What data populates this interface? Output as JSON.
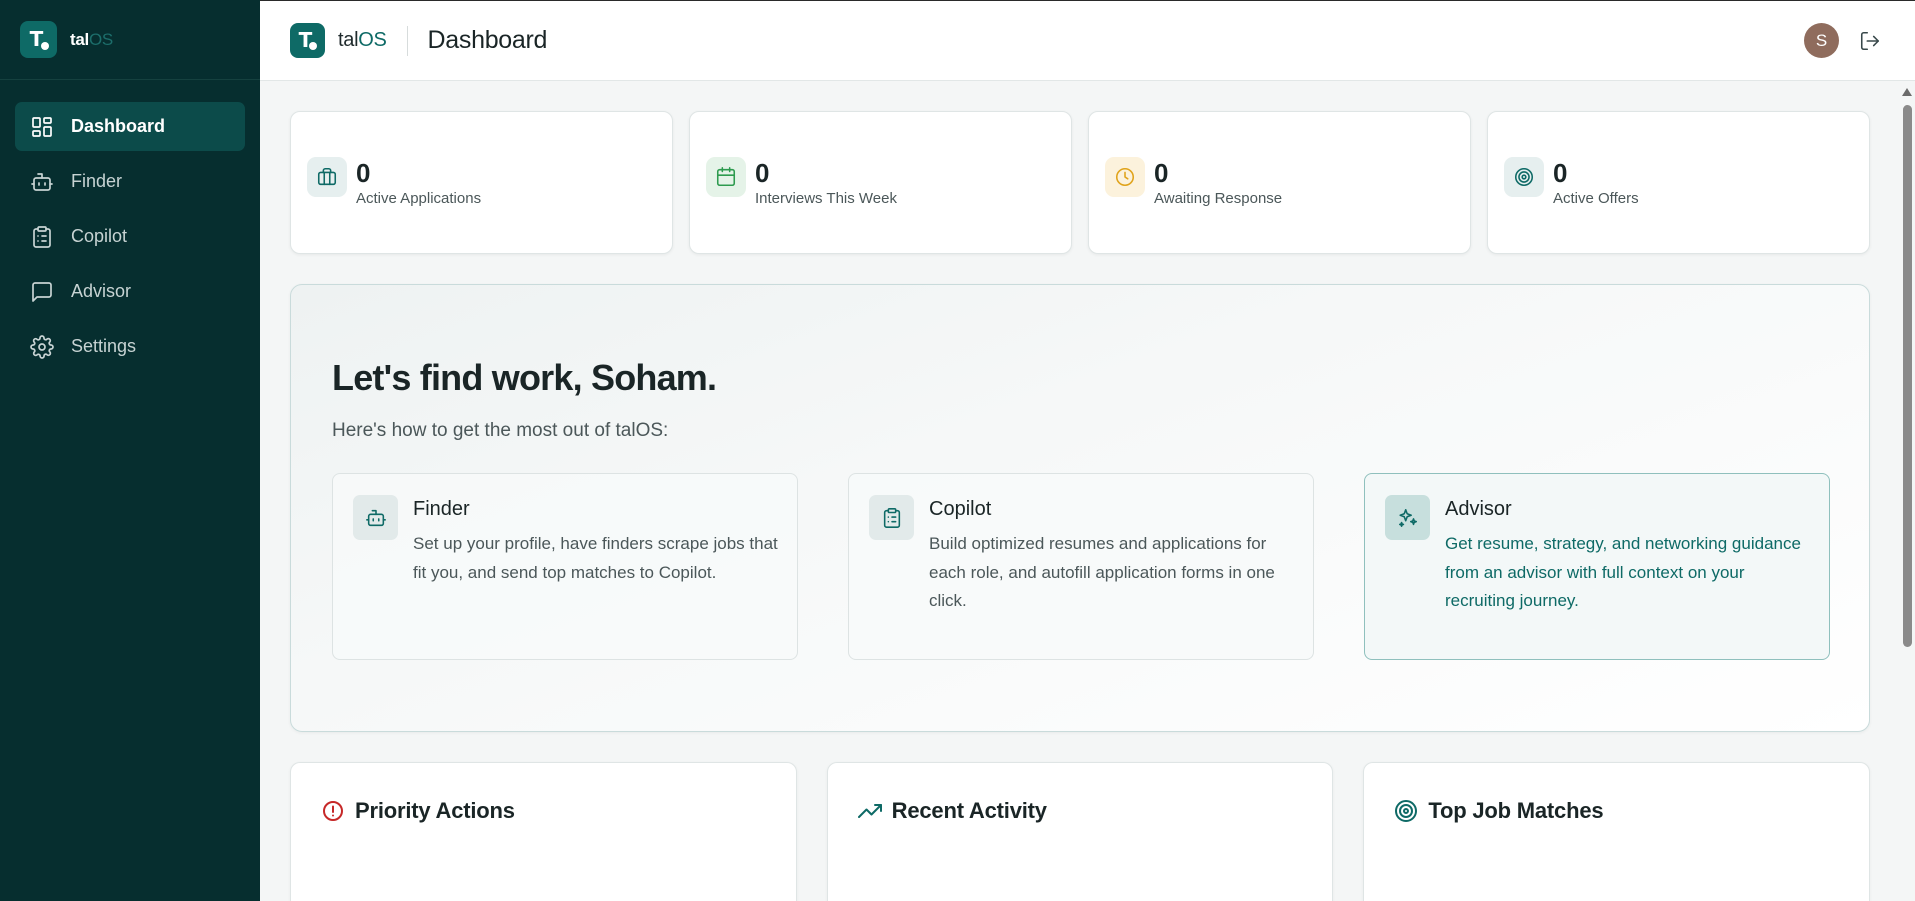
{
  "brand": {
    "tal": "tal",
    "os": "OS"
  },
  "header": {
    "page_title": "Dashboard",
    "avatar_initial": "S"
  },
  "sidebar": {
    "items": [
      {
        "label": "Dashboard",
        "icon": "dashboard-icon",
        "active": true
      },
      {
        "label": "Finder",
        "icon": "bot-icon"
      },
      {
        "label": "Copilot",
        "icon": "clipboard-icon"
      },
      {
        "label": "Advisor",
        "icon": "message-square-icon"
      },
      {
        "label": "Settings",
        "icon": "gear-icon"
      }
    ]
  },
  "stats": [
    {
      "value": "0",
      "label": "Active Applications",
      "icon": "briefcase-icon",
      "color": "#0e6a66"
    },
    {
      "value": "0",
      "label": "Interviews This Week",
      "icon": "calendar-icon",
      "color": "#2e9b4f"
    },
    {
      "value": "0",
      "label": "Awaiting Response",
      "icon": "clock-icon",
      "color": "#e0a31a"
    },
    {
      "value": "0",
      "label": "Active Offers",
      "icon": "target-icon",
      "color": "#0e6a66"
    }
  ],
  "hero": {
    "title": "Let's find work, Soham.",
    "subtitle": "Here's how to get the most out of talOS:",
    "features": [
      {
        "title": "Finder",
        "description": "Set up your profile, have finders scrape jobs that fit you, and send top matches to Copilot.",
        "icon": "bot-icon"
      },
      {
        "title": "Copilot",
        "description": "Build optimized resumes and applications for each role, and autofill application forms in one click.",
        "icon": "clipboard-icon"
      },
      {
        "title": "Advisor",
        "description": "Get resume, strategy, and networking guidance from an advisor with full context on your recruiting journey.",
        "icon": "sparkles-icon"
      }
    ]
  },
  "panels": [
    {
      "title": "Priority Actions",
      "icon": "alert-circle-icon",
      "color": "#c62828"
    },
    {
      "title": "Recent Activity",
      "icon": "trending-up-icon",
      "color": "#0e6a66"
    },
    {
      "title": "Top Job Matches",
      "icon": "target-icon",
      "color": "#0e6a66"
    }
  ],
  "colors": {
    "sidebar_bg": "#062e2f",
    "accent": "#0e6a66",
    "active_nav": "#0c4b4a"
  }
}
